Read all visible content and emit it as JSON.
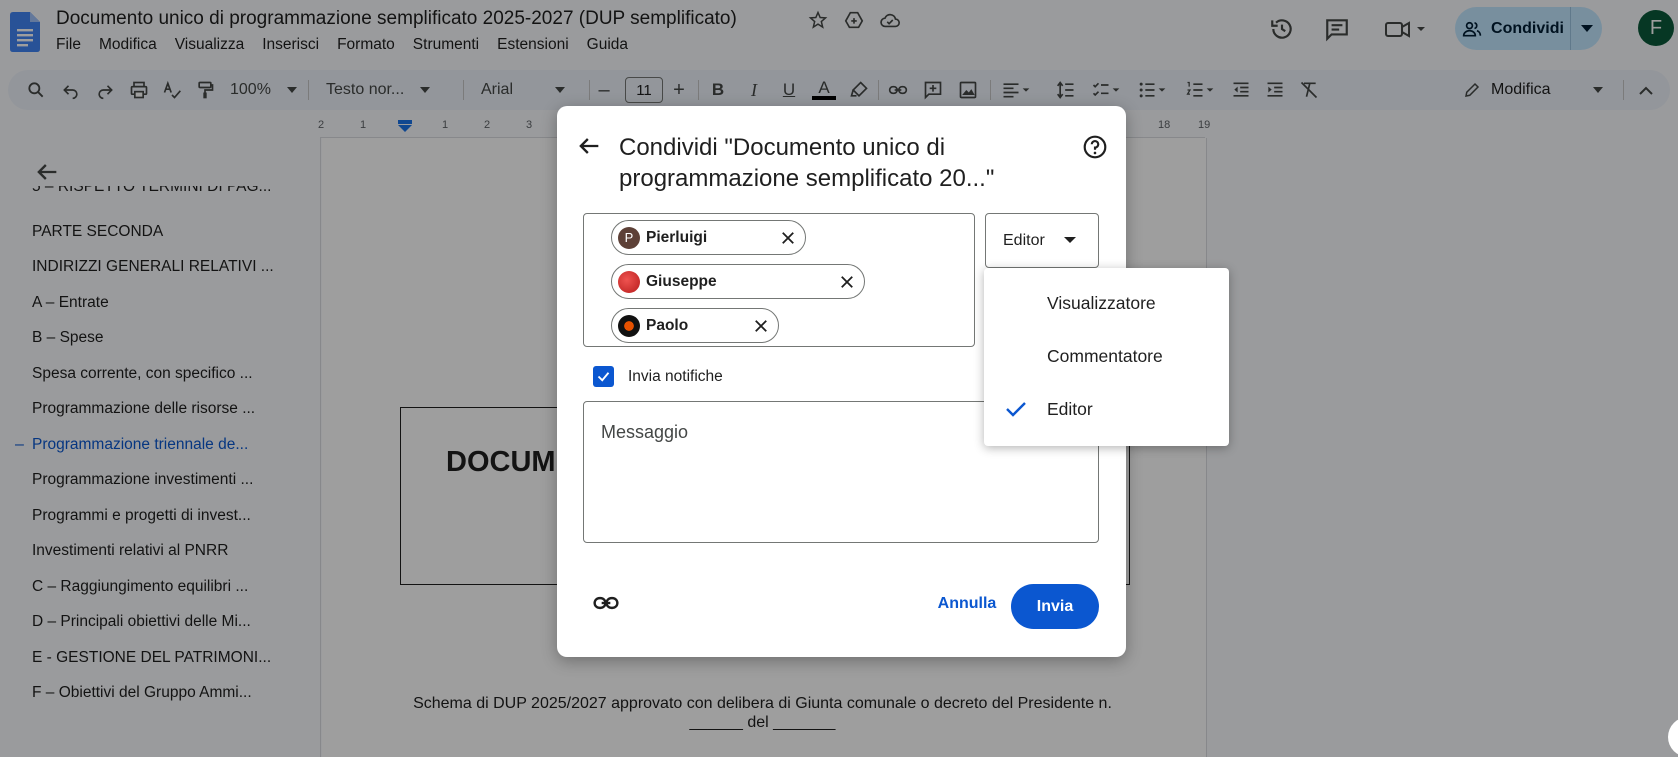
{
  "doc": {
    "title": "Documento unico di programmazione semplificato 2025-2027 (DUP semplificato)",
    "menu": [
      "File",
      "Modifica",
      "Visualizza",
      "Inserisci",
      "Formato",
      "Strumenti",
      "Estensioni",
      "Guida"
    ],
    "share_label": "Condividi",
    "user_initial": "F"
  },
  "toolbar": {
    "zoom": "100%",
    "style": "Testo nor...",
    "font": "Arial",
    "font_size": "11",
    "minus": "–",
    "plus": "+",
    "bold": "B",
    "italic": "I",
    "underline": "U",
    "text_color": "A",
    "mode": "Modifica"
  },
  "ruler": {
    "numbers": [
      "2",
      "1",
      "1",
      "2",
      "3",
      "18",
      "19"
    ]
  },
  "outline": {
    "items": [
      "5 – RISPETTO TERMINI DI PAG...",
      "PARTE SECONDA",
      "INDIRIZZI GENERALI RELATIVI ...",
      "A – Entrate",
      "B – Spese",
      "Spesa corrente, con specifico ...",
      "Programmazione delle risorse ...",
      "Programmazione triennale de...",
      "Programmazione investimenti ...",
      "Programmi e progetti di invest...",
      "Investimenti relativi al PNRR",
      "C – Raggiungimento equilibri ...",
      "D – Principali obiettivi delle Mi...",
      "E - GESTIONE DEL PATRIMONI...",
      "F – Obiettivi del Gruppo Ammi..."
    ],
    "active_marker": "–"
  },
  "page": {
    "heading": "DOCUM",
    "footer_line1": "Schema di DUP 2025/2027 approvato con delibera di Giunta comunale o decreto del Presidente n.",
    "footer_line2": "______ del _______"
  },
  "dialog": {
    "title": "Condividi \"Documento unico di programmazione semplificato 20...\"",
    "people": [
      {
        "name": "Pierluigi",
        "initial": "P",
        "color": "#5d4037"
      },
      {
        "name": "Giuseppe",
        "initial": "",
        "color": "#c62828"
      },
      {
        "name": "Paolo",
        "initial": "",
        "color": "#212121"
      }
    ],
    "role": "Editor",
    "notify_label": "Invia notifiche",
    "message_placeholder": "Messaggio",
    "cancel": "Annulla",
    "send": "Invia"
  },
  "role_menu": {
    "options": [
      "Visualizzatore",
      "Commentatore",
      "Editor"
    ],
    "selected": "Editor"
  },
  "colors": {
    "accent": "#0b57d0",
    "share_bg": "#c2e7ff",
    "avatar_bg": "#0b5a3a"
  }
}
